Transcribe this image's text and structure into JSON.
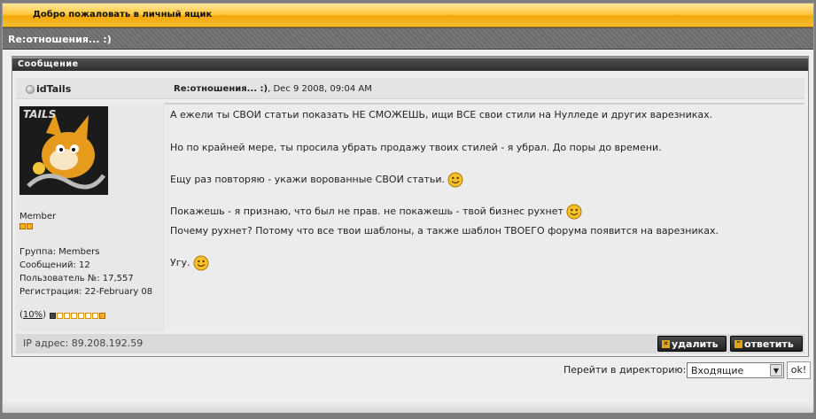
{
  "header": {
    "welcome": "Добро пожаловать в личный ящик"
  },
  "topic": {
    "title": "Re:отношения... :)"
  },
  "message_box": {
    "title": "Сообщение"
  },
  "post": {
    "author": "idTails",
    "title": "Re:отношения... :)",
    "date_suffix": ", Dec 9 2008, 09:04 AM",
    "lines": [
      "А ежели ты СВОИ статьи показать НЕ СМОЖЕШЬ, ищи ВСЕ свои стили на Нулледе и других варезниках.",
      "Но по крайней мере, ты просила убрать продажу твоих стилей - я убрал. До поры до времени.",
      "Ещу раз повторяю - укажи ворованные СВОИ статьи.",
      "Покажешь - я признаю, что был не прав. не покажешь - твой бизнес рухнет",
      "Почему рухнет? Потому что все твои шаблоны, а также шаблон ТВОЕГО форума появится на варезниках.",
      "Угу."
    ],
    "ip": "IP адрес: 89.208.192.59"
  },
  "sidebar": {
    "avatar_text": "TAILS",
    "role": "Member",
    "group": "Группа: Members",
    "posts": "Сообщений: 12",
    "member_no": "Пользователь №: 17,557",
    "registered": "Регистрация: 22-February 08",
    "warn_open": "(",
    "warn_pct": "10%",
    "warn_close": ")"
  },
  "actions": {
    "delete": "удалить",
    "reply": "ответить"
  },
  "jump": {
    "label": "Перейти в директорию:",
    "selected": "Входящие",
    "ok": "ok!"
  },
  "colors": {
    "accent": "#f7bd2f",
    "dark_bar": "#3a3a3a",
    "background": "#7c7c7c"
  },
  "icons": {
    "smiley": "smiley-icon",
    "status": "offline-status-icon"
  }
}
